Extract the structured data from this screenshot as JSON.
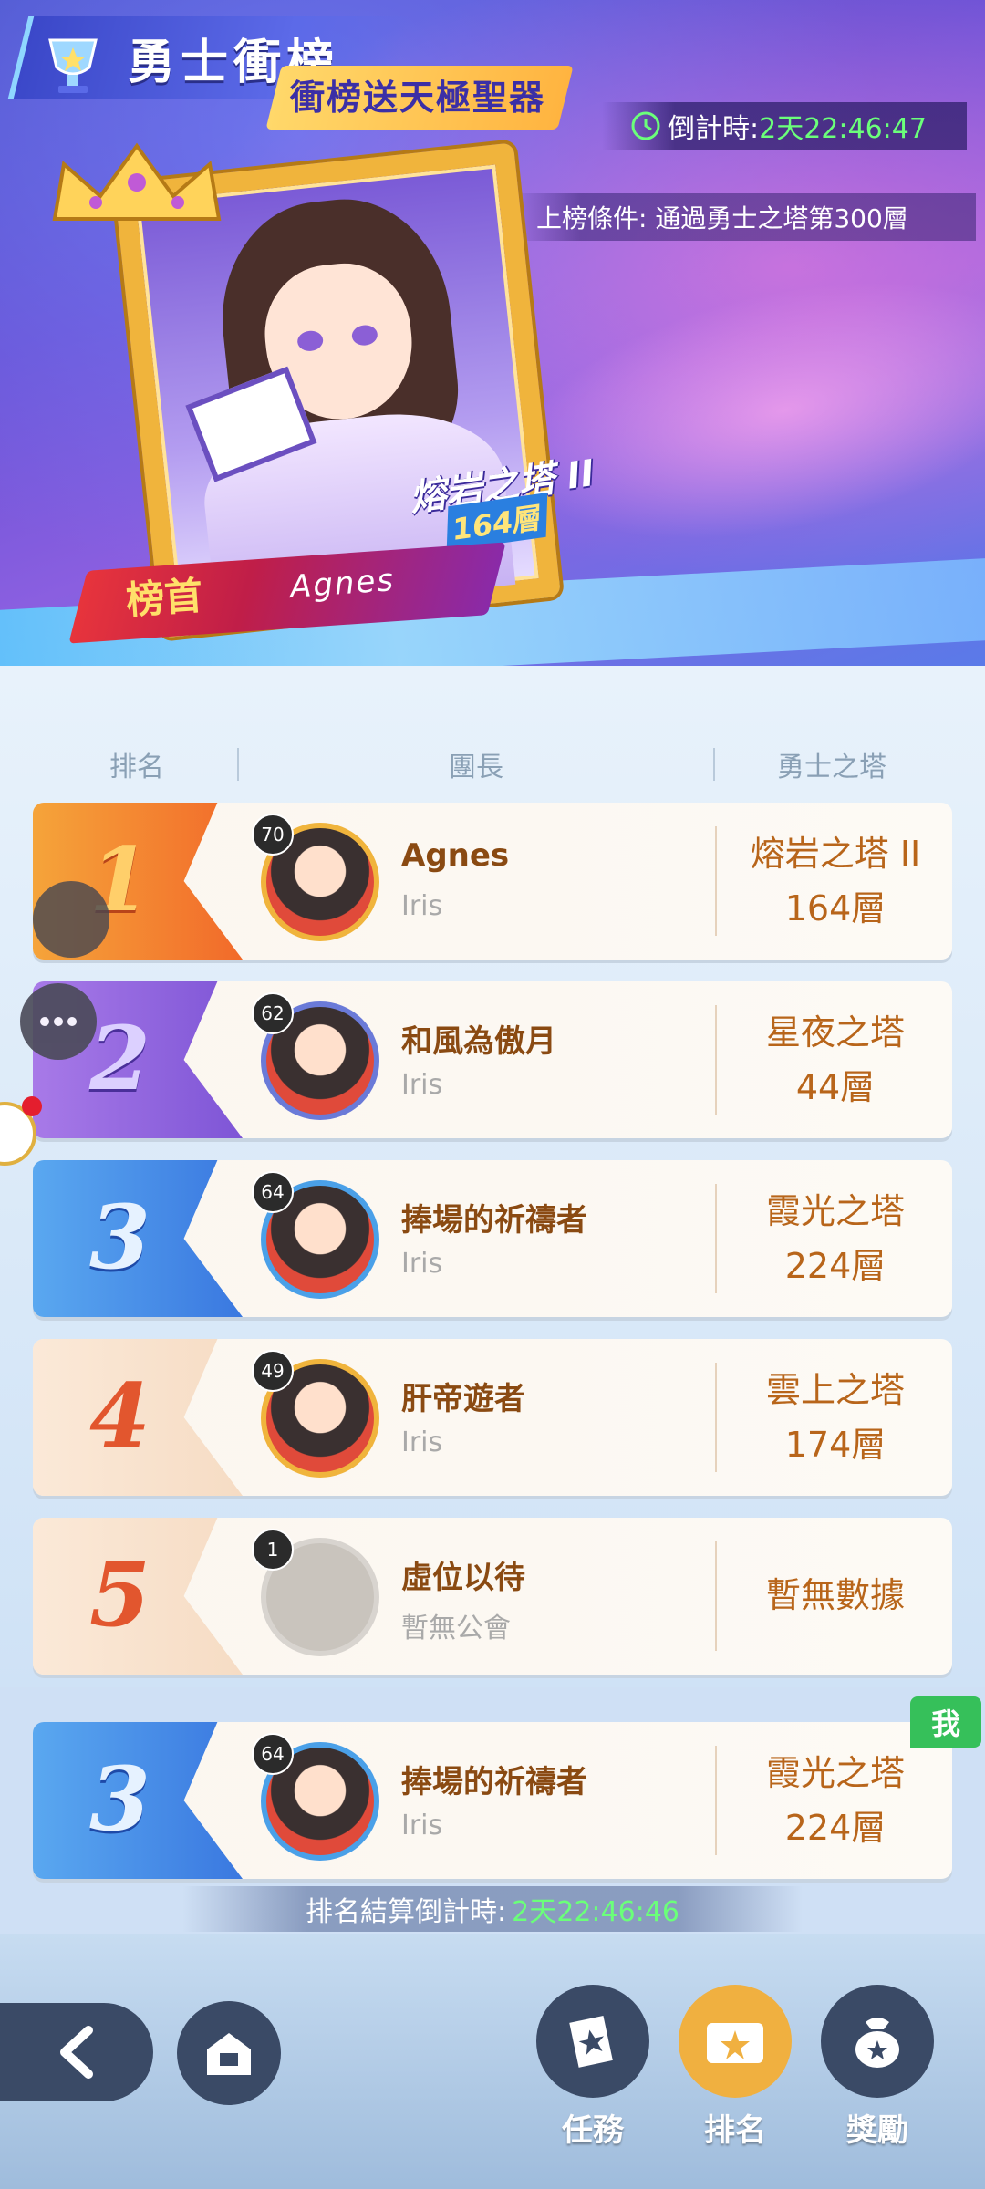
{
  "header": {
    "title": "勇士衝榜",
    "subtitle": "衝榜送天極聖器",
    "countdown_label": "倒計時:",
    "countdown_value": "2天22:46:47",
    "condition": "上榜條件: 通過勇士之塔第300層"
  },
  "featured": {
    "tower_name": "熔岩之塔 II",
    "tower_floor": "164層",
    "top_label": "榜首",
    "top_name": "Agnes"
  },
  "columns": {
    "rank": "排名",
    "leader": "團長",
    "tower": "勇士之塔"
  },
  "rows": [
    {
      "rank": "1",
      "level": "70",
      "name": "Agnes",
      "guild": "Iris",
      "tower": "熔岩之塔 II",
      "floor": "164層"
    },
    {
      "rank": "2",
      "level": "62",
      "name": "和風為傲月",
      "guild": "Iris",
      "tower": "星夜之塔",
      "floor": "44層"
    },
    {
      "rank": "3",
      "level": "64",
      "name": "捧場的祈禱者",
      "guild": "Iris",
      "tower": "霞光之塔",
      "floor": "224層"
    },
    {
      "rank": "4",
      "level": "49",
      "name": "肝帝遊者",
      "guild": "Iris",
      "tower": "雲上之塔",
      "floor": "174層"
    },
    {
      "rank": "5",
      "level": "1",
      "name": "虛位以待",
      "guild": "暫無公會",
      "tower": "暫無數據",
      "floor": ""
    }
  ],
  "me": {
    "badge": "我",
    "rank": "3",
    "level": "64",
    "name": "捧場的祈禱者",
    "guild": "Iris",
    "tower": "霞光之塔",
    "floor": "224層"
  },
  "settlement": {
    "label": "排名結算倒計時:",
    "value": "2天22:46:46"
  },
  "nav": {
    "tasks": "任務",
    "ranking": "排名",
    "rewards": "獎勵"
  },
  "colors": {
    "gold": "#f0b43c",
    "purple": "#8a5fe0",
    "blue": "#4aa0e8",
    "countdown_green": "#6bff7a",
    "name_brown": "#8a4a12",
    "tower_orange": "#b8651a"
  },
  "icons": {
    "title": "trophy-icon",
    "countdown": "clock-icon",
    "back": "back-arrow-icon",
    "home": "home-icon",
    "tasks": "book-icon",
    "ranking": "ranking-board-icon",
    "rewards": "reward-bag-icon",
    "chat": "chat-bubble-icon"
  }
}
